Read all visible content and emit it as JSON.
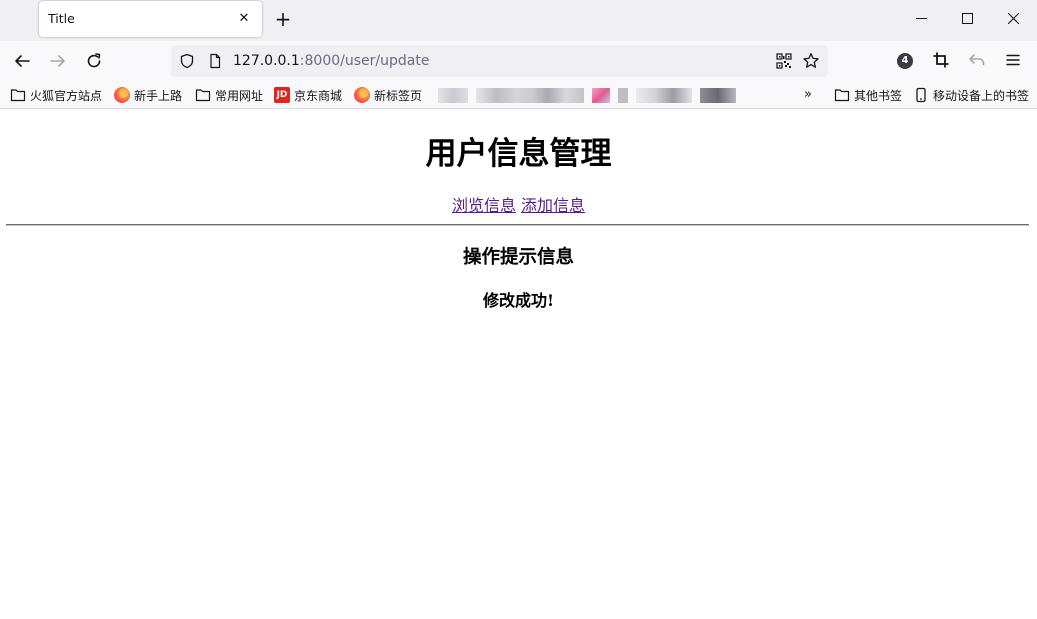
{
  "tab": {
    "title": "Title"
  },
  "urlbar": {
    "host": "127.0.0.1",
    "rest": ":8000/user/update"
  },
  "toolbar": {
    "extension_badge": "4"
  },
  "bookmarks": {
    "items": [
      {
        "label": "火狐官方站点",
        "icon": "folder-icon"
      },
      {
        "label": "新手上路",
        "icon": "firefox-icon"
      },
      {
        "label": "常用网址",
        "icon": "folder-icon"
      },
      {
        "label": "京东商城",
        "icon": "jd-icon",
        "icon_text": "JD"
      },
      {
        "label": "新标签页",
        "icon": "firefox-icon"
      }
    ],
    "other": "其他书签",
    "mobile": "移动设备上的书签"
  },
  "page": {
    "title": "用户信息管理",
    "links": [
      "浏览信息",
      "添加信息"
    ],
    "section_title": "操作提示信息",
    "message": "修改成功!"
  },
  "colors": {
    "link": "#551a8b",
    "tabstrip": "#f0f0f4",
    "toolbar": "#f9f9fb",
    "jd_red": "#e1251b"
  }
}
